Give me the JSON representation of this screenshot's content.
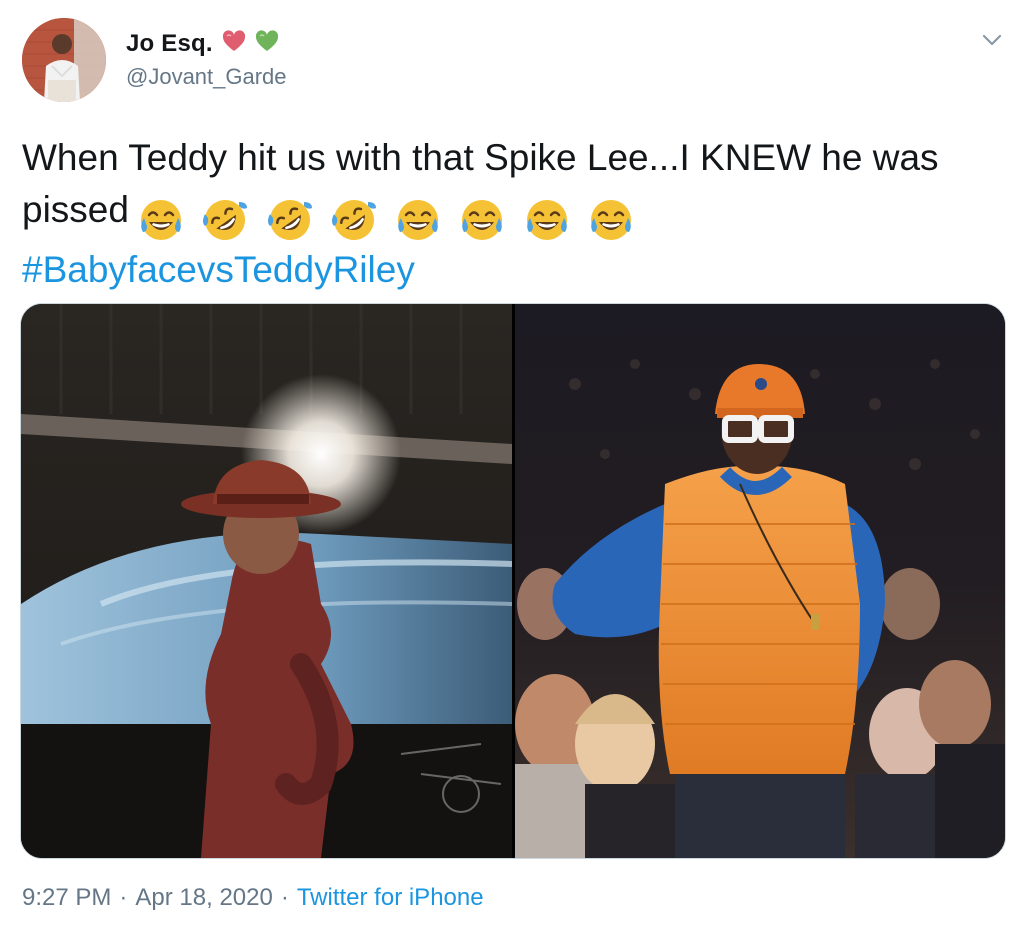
{
  "author": {
    "display_name": "Jo Esq.",
    "name_emojis": [
      "heart-icon",
      "green-heart-icon"
    ],
    "handle": "@Jovant_Garde"
  },
  "tweet": {
    "line1": "When Teddy hit us with that Spike Lee...I KNEW he was",
    "line2": "pissed",
    "emojis": [
      "tears-of-joy-emoji",
      "rofl-emoji",
      "rofl-emoji",
      "rofl-emoji",
      "tears-of-joy-emoji",
      "tears-of-joy-emoji",
      "tears-of-joy-emoji",
      "tears-of-joy-emoji"
    ],
    "hashtag": "#BabyfacevsTeddyRiley"
  },
  "media": {
    "images": [
      "teddy-riley-on-stage-photo",
      "spike-lee-courtside-photo"
    ]
  },
  "footer": {
    "time": "9:27 PM",
    "separator": "·",
    "date": "Apr 18, 2020",
    "source": "Twitter for iPhone"
  },
  "colors": {
    "link": "#1b95e0",
    "secondary_text": "#657786",
    "border": "#ccd6dd"
  }
}
